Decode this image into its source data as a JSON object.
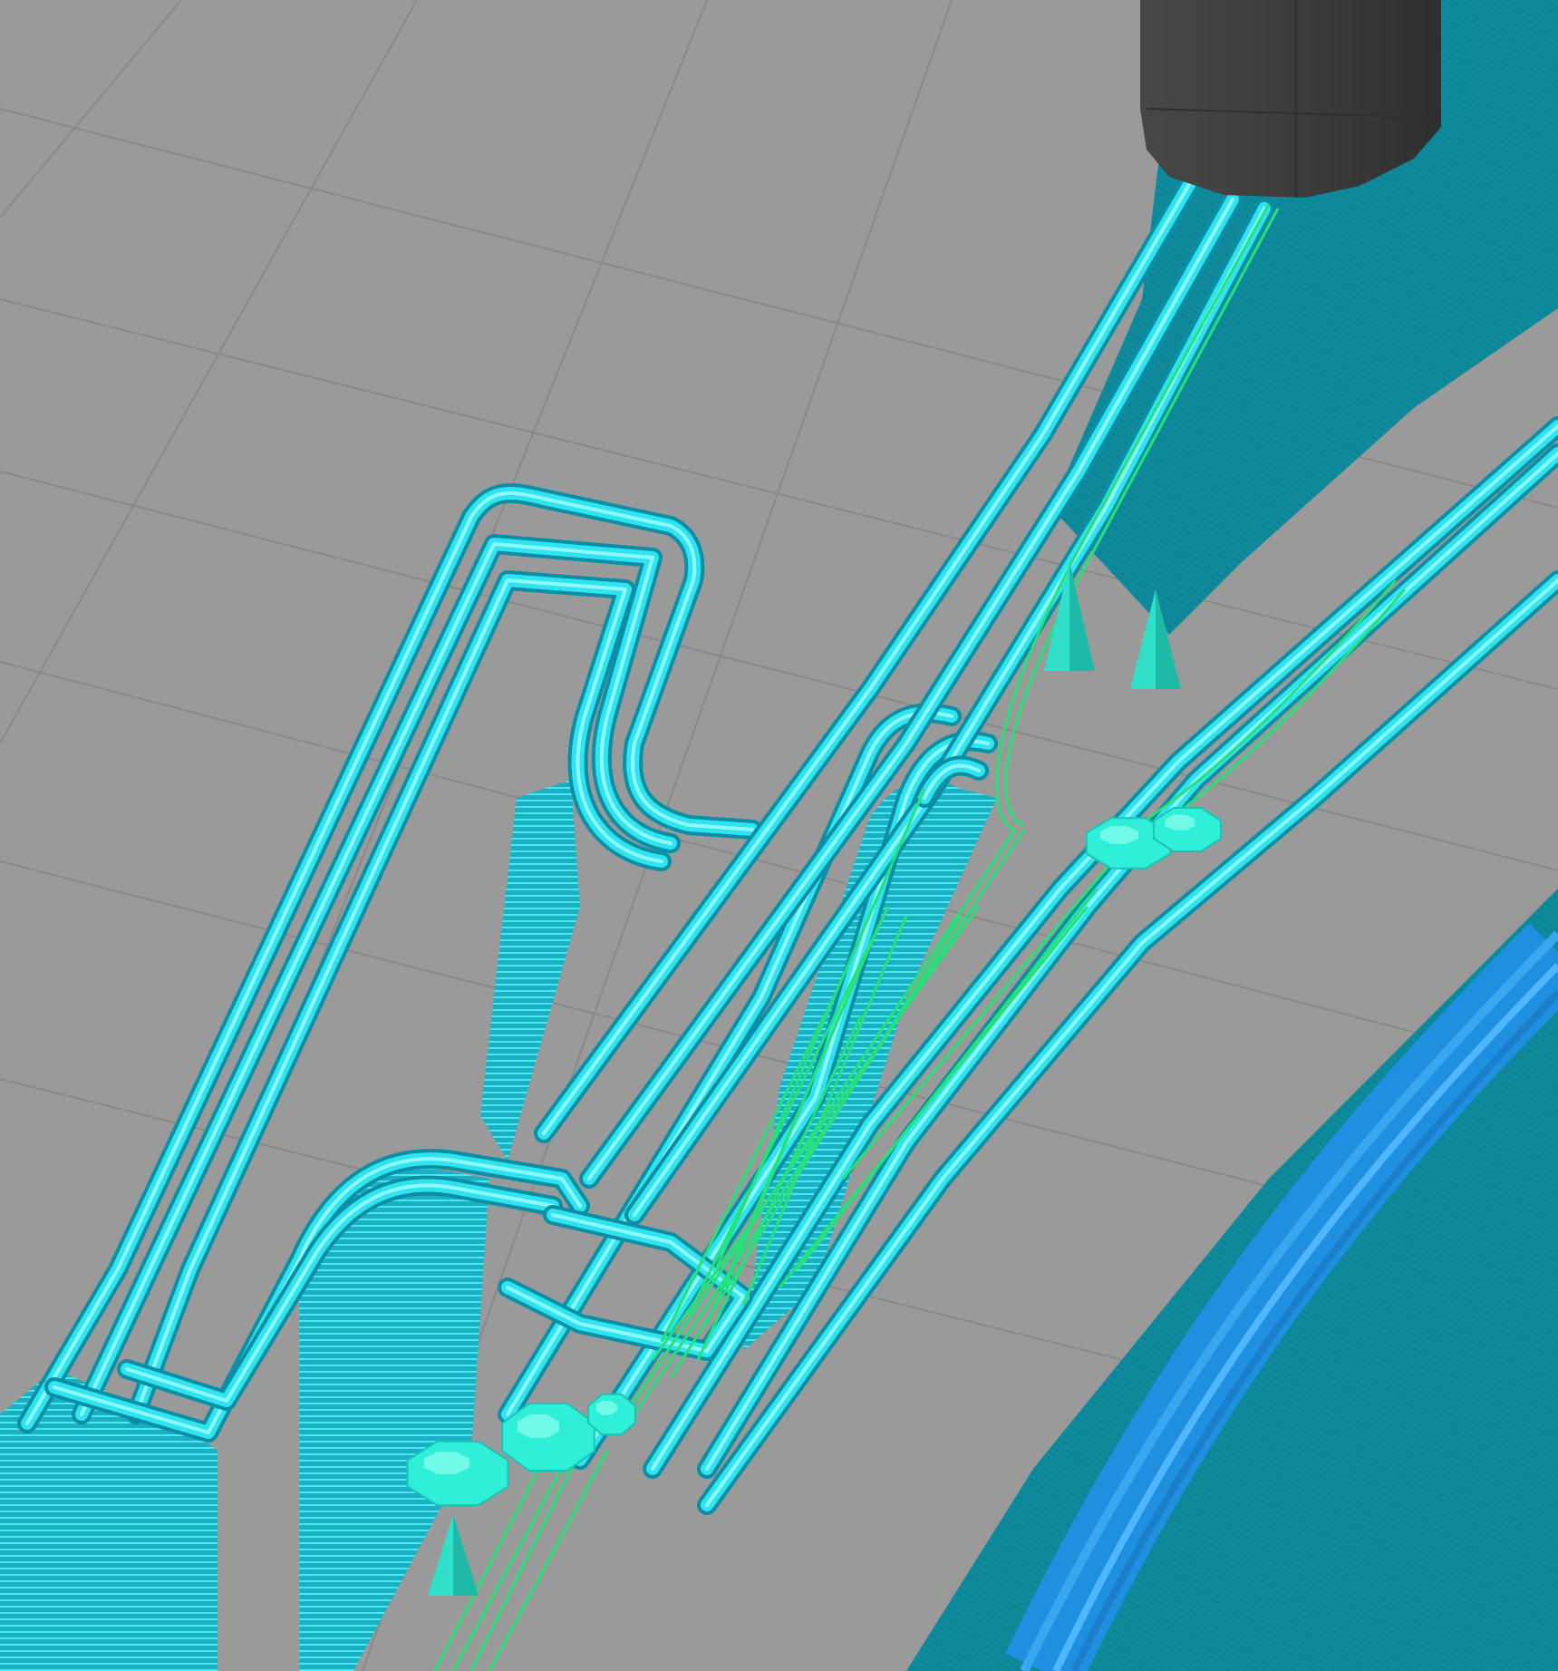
{
  "viewer": {
    "view": "gcode-preview-3d",
    "background_color": "#9a9a9a",
    "bed_grid_color": "#8a8a8a",
    "colors": {
      "perimeter_top": "#2fe4ee",
      "perimeter_highlight": "#8ff8ff",
      "wall_face": "#0e8a9c",
      "wall_face_dark": "#0a7585",
      "layer_lines": "#18c6d8",
      "travel_move": "#27e07a",
      "retraction_marker": "#2fefd8",
      "lower_layer_blue": "#1f8fe0",
      "nozzle": "#3d3d3d"
    },
    "objects": [
      {
        "kind": "nozzle",
        "icon": "nozzle-icon"
      },
      {
        "kind": "extruded-part",
        "icon": "toolpath-icon"
      },
      {
        "kind": "travel-moves",
        "icon": "travel-move-icon"
      },
      {
        "kind": "retraction-markers",
        "icon": "retraction-icon"
      }
    ]
  }
}
